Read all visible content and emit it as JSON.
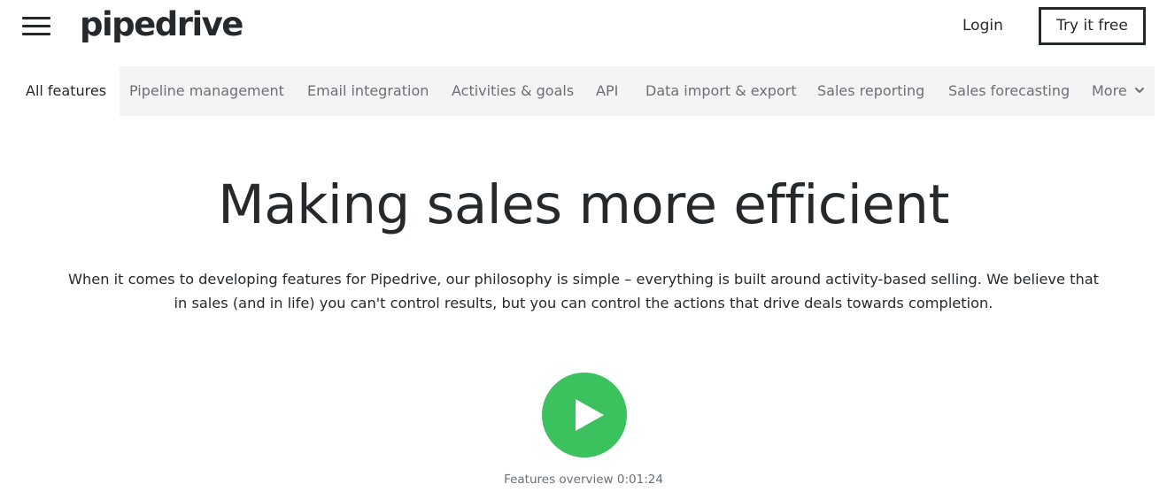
{
  "header": {
    "menu_icon": "hamburger-menu-icon",
    "logo_text": "pipedrive",
    "login_label": "Login",
    "try_label": "Try it free"
  },
  "feature_nav": {
    "items": [
      {
        "label": "All features",
        "active": true
      },
      {
        "label": "Pipeline management"
      },
      {
        "label": "Email integration"
      },
      {
        "label": "Activities & goals"
      },
      {
        "label": "API"
      },
      {
        "label": "Data import & export"
      },
      {
        "label": "Sales reporting"
      },
      {
        "label": "Sales forecasting"
      },
      {
        "label": "More",
        "icon": "chevron-down-icon"
      }
    ]
  },
  "hero": {
    "title": "Making sales more efficient",
    "line1": "When it comes to developing features for Pipedrive, our philosophy is simple – everything is built around activity-based selling. We believe that",
    "line2": "in sales (and in life) you can't control results, but you can control the actions that drive deals towards completion."
  },
  "video": {
    "play_icon": "play-icon",
    "caption": "Features overview 0:01:24"
  },
  "colors": {
    "text": "#26292c",
    "muted": "#6b7076",
    "nav_bg": "#f3f4f5",
    "accent_green": "#3bc15d"
  }
}
